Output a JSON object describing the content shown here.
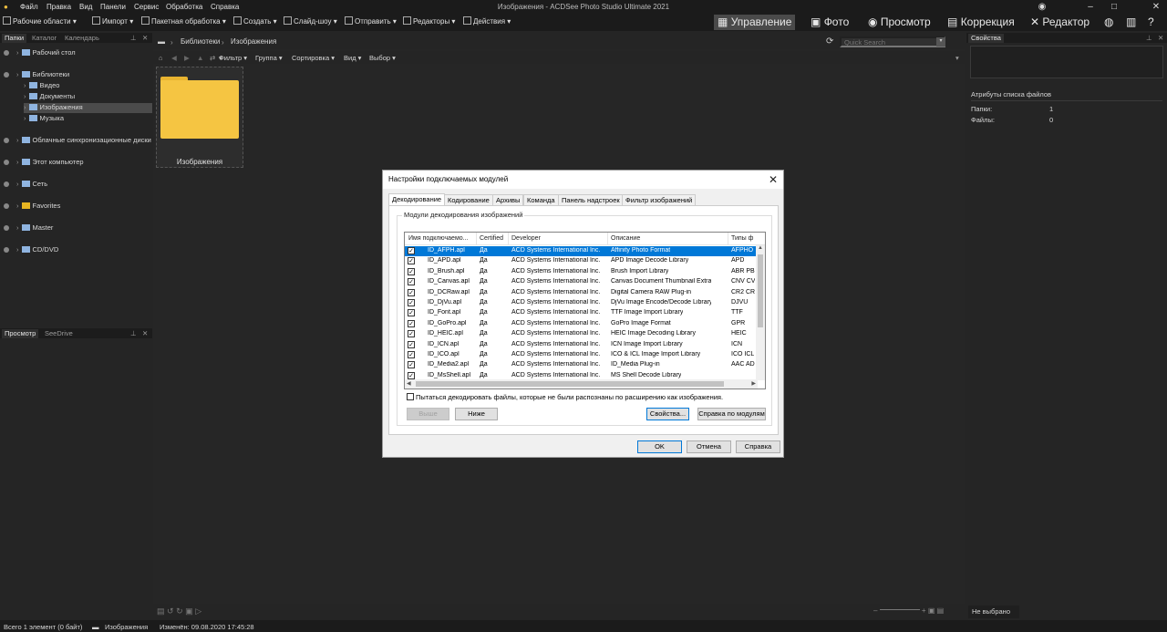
{
  "menu": {
    "items": [
      "Файл",
      "Правка",
      "Вид",
      "Панели",
      "Сервис",
      "Обработка",
      "Справка"
    ],
    "title": "Изображения - ACDSee Photo Studio Ultimate 2021"
  },
  "toolbar": {
    "workspaces": "Рабочие области",
    "import": "Импорт",
    "batch": "Пакетная обработка",
    "create": "Создать",
    "slideshow": "Слайд-шоу",
    "send": "Отправить",
    "editors": "Редакторы",
    "actions": "Действия"
  },
  "modes": [
    "Управление",
    "Фото",
    "Просмотр",
    "Коррекция",
    "Редактор"
  ],
  "left_panel": {
    "tabs": [
      "Папки",
      "Каталог",
      "Календарь"
    ],
    "tree": [
      {
        "label": "Рабочий стол",
        "level": 0,
        "icon": "desktop-icon"
      },
      {
        "label": "Библиотеки",
        "level": 0,
        "icon": "library-icon"
      },
      {
        "label": "Видео",
        "level": 1,
        "icon": "video-icon"
      },
      {
        "label": "Документы",
        "level": 1,
        "icon": "documents-icon"
      },
      {
        "label": "Изображения",
        "level": 1,
        "icon": "pictures-icon",
        "selected": true
      },
      {
        "label": "Музыка",
        "level": 1,
        "icon": "music-icon"
      },
      {
        "label": "Облачные синхронизационные диски",
        "level": 0,
        "icon": "cloud-icon"
      },
      {
        "label": "Этот компьютер",
        "level": 0,
        "icon": "computer-icon"
      },
      {
        "label": "Сеть",
        "level": 0,
        "icon": "network-icon"
      },
      {
        "label": "Favorites",
        "level": 0,
        "icon": "star-icon"
      },
      {
        "label": "Master",
        "level": 0,
        "icon": "person-icon"
      },
      {
        "label": "CD/DVD",
        "level": 0,
        "icon": "disc-icon"
      }
    ],
    "preview_tabs": [
      "Просмотр",
      "SeeDrive"
    ]
  },
  "address": {
    "crumbs": [
      "Библиотеки",
      "Изображения"
    ],
    "search_placeholder": "Quick Search"
  },
  "filter_bar": [
    "Фильтр",
    "Группа",
    "Сортировка",
    "Вид",
    "Выбор"
  ],
  "thumbnail": {
    "label": "Изображения"
  },
  "right_panel": {
    "title": "Свойства",
    "attrs_title": "Атрибуты списка файлов",
    "folders_label": "Папки:",
    "folders_value": "1",
    "files_label": "Файлы:",
    "files_value": "0",
    "bottom_tab": "Не выбрано"
  },
  "status": {
    "total": "Всего 1 элемент  (0 байт)",
    "location": "Изображения",
    "modified": "Изменён: 09.08.2020 17:45:28"
  },
  "dialog": {
    "title": "Настройки подключаемых модулей",
    "tabs": [
      "Декодирование",
      "Кодирование",
      "Архивы",
      "Команда",
      "Панель надстроек",
      "Фильтр изображений"
    ],
    "group_label": "Модули декодирования изображений",
    "columns": [
      "Имя подключаемо...",
      "Certified",
      "Developer",
      "Описание",
      "Типы ф"
    ],
    "rows": [
      {
        "name": "ID_AFPH.apl",
        "certified": "Да",
        "developer": "ACD Systems International Inc.",
        "description": "Affinity Photo Format",
        "types": "AFPHO"
      },
      {
        "name": "ID_APD.apl",
        "certified": "Да",
        "developer": "ACD Systems International Inc.",
        "description": "APD Image Decode Library",
        "types": "APD"
      },
      {
        "name": "ID_Brush.apl",
        "certified": "Да",
        "developer": "ACD Systems International Inc.",
        "description": "Brush Import Library",
        "types": "ABR PB"
      },
      {
        "name": "ID_Canvas.apl",
        "certified": "Да",
        "developer": "ACD Systems International Inc.",
        "description": "Canvas Document Thumbnail Extractor",
        "types": "CNV CV"
      },
      {
        "name": "ID_DCRaw.apl",
        "certified": "Да",
        "developer": "ACD Systems International Inc.",
        "description": "Digital Camera RAW Plug-in",
        "types": "CR2 CR"
      },
      {
        "name": "ID_DjVu.apl",
        "certified": "Да",
        "developer": "ACD Systems International Inc.",
        "description": "DjVu Image Encode/Decode Library",
        "types": "DJVU"
      },
      {
        "name": "ID_Font.apl",
        "certified": "Да",
        "developer": "ACD Systems International Inc.",
        "description": "TTF Image Import Library",
        "types": "TTF"
      },
      {
        "name": "ID_GoPro.apl",
        "certified": "Да",
        "developer": "ACD Systems International Inc.",
        "description": "GoPro Image Format",
        "types": "GPR"
      },
      {
        "name": "ID_HEIC.apl",
        "certified": "Да",
        "developer": "ACD Systems International Inc.",
        "description": "HEIC Image Decoding Library",
        "types": "HEIC"
      },
      {
        "name": "ID_ICN.apl",
        "certified": "Да",
        "developer": "ACD Systems International Inc.",
        "description": "ICN Image Import Library",
        "types": "ICN"
      },
      {
        "name": "ID_ICO.apl",
        "certified": "Да",
        "developer": "ACD Systems International Inc.",
        "description": "ICO & ICL Image Import Library",
        "types": "ICO ICL"
      },
      {
        "name": "ID_Media2.apl",
        "certified": "Да",
        "developer": "ACD Systems International Inc.",
        "description": "ID_Media Plug-in",
        "types": "AAC AD"
      },
      {
        "name": "ID_MsShell.apl",
        "certified": "Да",
        "developer": "ACD Systems International Inc.",
        "description": "MS Shell Decode Library",
        "types": ""
      }
    ],
    "try_decode": "Пытаться декодировать файлы, которые не были распознаны по расширению как изображения.",
    "btn_up": "Выше",
    "btn_down": "Ниже",
    "btn_props": "Свойства...",
    "btn_help_modules": "Справка по модулям",
    "btn_ok": "OK",
    "btn_cancel": "Отмена",
    "btn_help": "Справка"
  }
}
